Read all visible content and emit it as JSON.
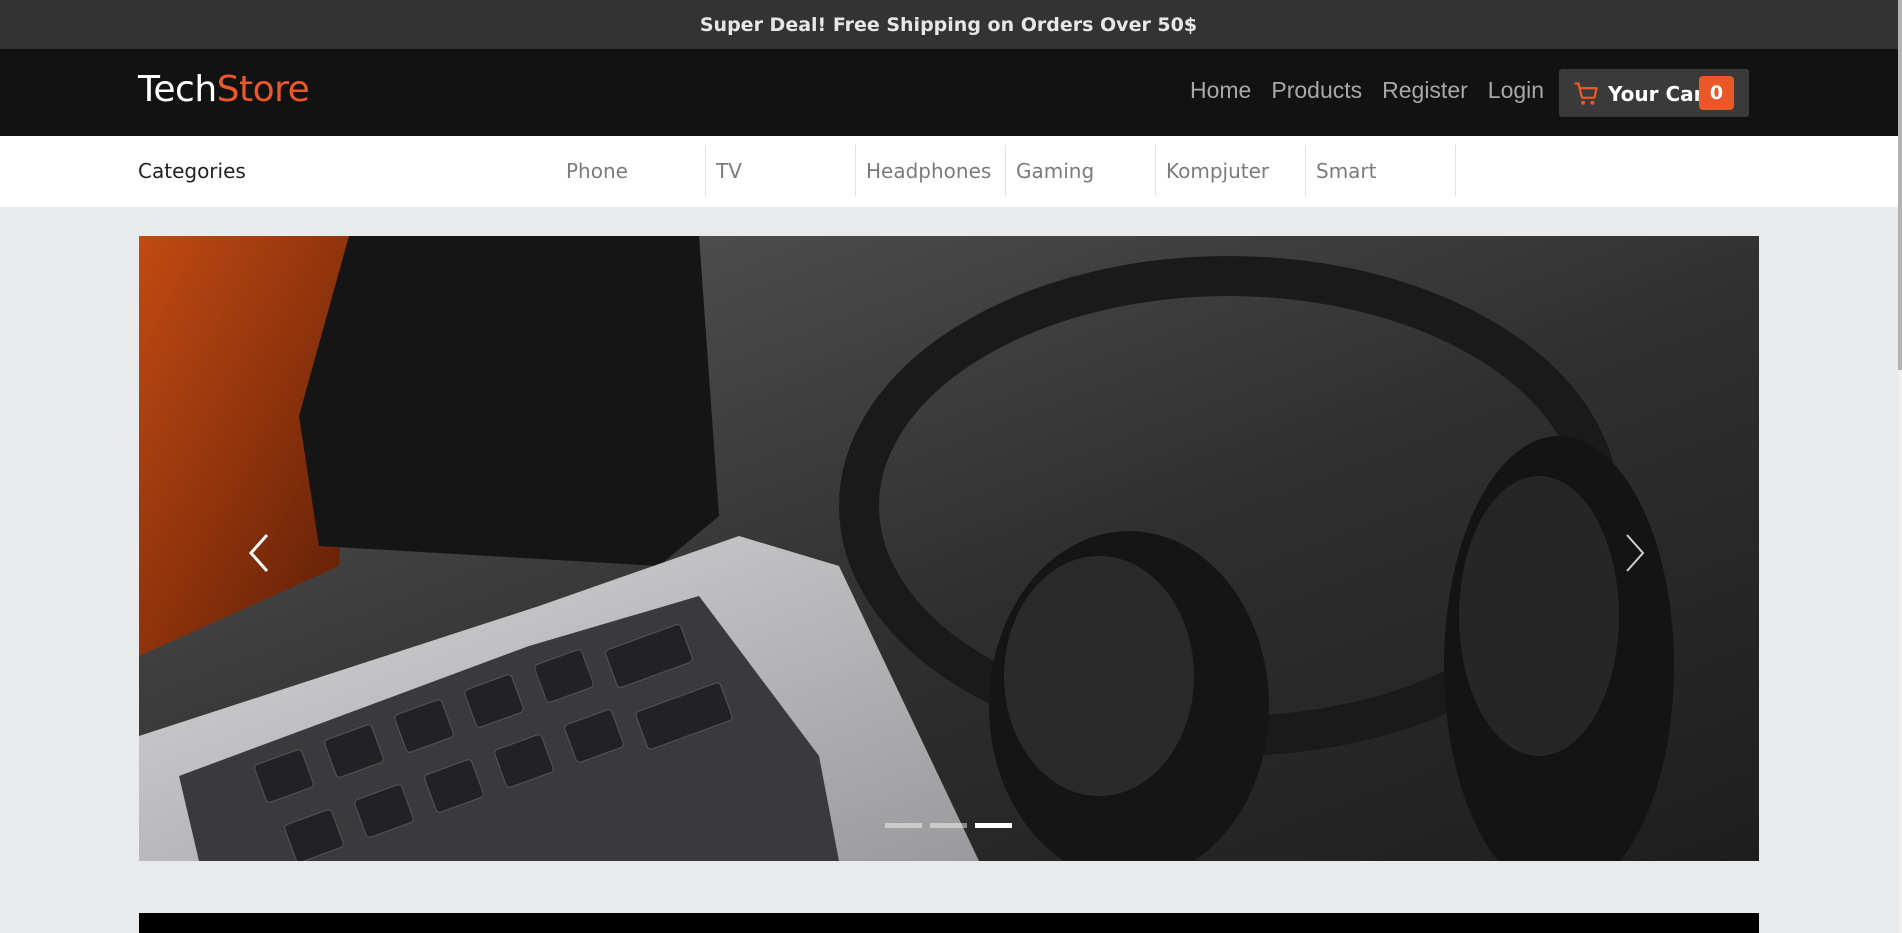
{
  "promo": {
    "text": "Super Deal! Free Shipping on Orders Over 50$"
  },
  "header": {
    "logo_part1": "Tech",
    "logo_part2": "Store",
    "nav": [
      "Home",
      "Products",
      "Register",
      "Login"
    ],
    "cart": {
      "label": "Your Cart",
      "count": "0",
      "icon": "cart-icon"
    }
  },
  "categories": {
    "title": "Categories",
    "items": [
      "Phone",
      "TV",
      "Headphones",
      "Gaming",
      "Kompjuter",
      "Smart"
    ]
  },
  "slider": {
    "total_slides": 3,
    "active_slide": 3,
    "prev_icon": "chevron-left-icon",
    "next_icon": "chevron-right-icon"
  },
  "colors": {
    "accent": "#ea5729",
    "promo_bg": "#333333",
    "header_bg": "#121212",
    "page_bg": "#e9eaec"
  }
}
